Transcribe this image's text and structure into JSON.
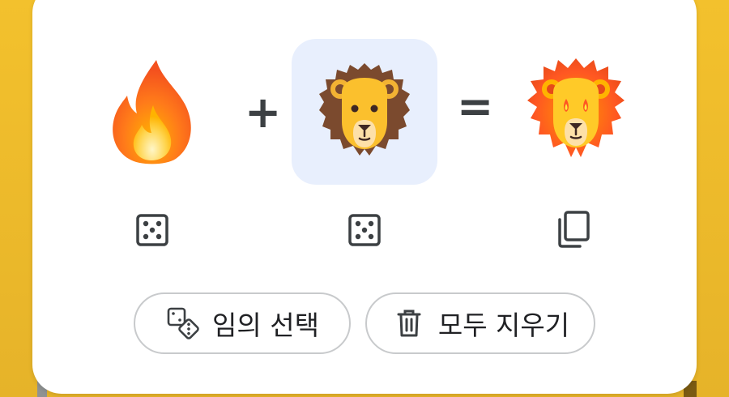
{
  "mixer": {
    "operator_plus": "+",
    "operator_equals": "=",
    "first_emoji": {
      "name": "fire"
    },
    "second_emoji": {
      "name": "lion-face"
    },
    "result_emoji": {
      "name": "fire-lion-mashup"
    }
  },
  "actions": {
    "random_label": "임의 선택",
    "clear_label": "모두 지우기"
  },
  "icons": {
    "dice": "dice-icon",
    "copy": "copy-icon",
    "trash": "trash-icon"
  },
  "colors": {
    "selected_slot_bg": "#e8effd",
    "card_bg": "#ffffff",
    "pill_border": "#c8cacc",
    "accent_yellow": "#f3c12d"
  }
}
